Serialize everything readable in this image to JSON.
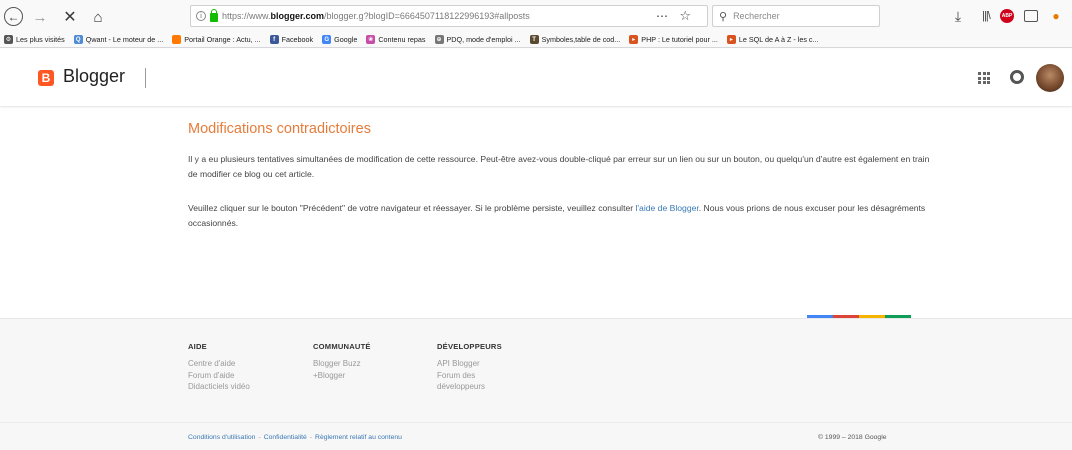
{
  "browser": {
    "url_prefix": "https://www.",
    "url_host": "blogger.com",
    "url_path": "/blogger.g?blogID=6664507118122996193#allposts",
    "search_placeholder": "Rechercher",
    "bookmarks": [
      {
        "label": "Les plus visités",
        "icon": "gear-icon",
        "color": "#555555"
      },
      {
        "label": "Qwant - Le moteur de ...",
        "icon": "qwant-icon",
        "color": "#4e8ad6"
      },
      {
        "label": "Portail Orange : Actu, ...",
        "icon": "orange-icon",
        "color": "#ff7900"
      },
      {
        "label": "Facebook",
        "icon": "facebook-icon",
        "color": "#3b5998"
      },
      {
        "label": "Google",
        "icon": "google-icon",
        "color": "#4285f4"
      },
      {
        "label": "Contenu repas",
        "icon": "flower-icon",
        "color": "#c64ea8"
      },
      {
        "label": "PDQ, mode d'emploi ...",
        "icon": "globe-icon",
        "color": "#777777"
      },
      {
        "label": "Symboles,table de cod...",
        "icon": "t-icon",
        "color": "#5a4a2f"
      },
      {
        "label": "PHP : Le tutoriel pour ...",
        "icon": "bookmark-icon",
        "color": "#d9531e"
      },
      {
        "label": "Le SQL de A à Z - les c...",
        "icon": "bookmark-icon",
        "color": "#d9531e"
      }
    ]
  },
  "header": {
    "logo_letter": "B",
    "app_name": "Blogger"
  },
  "error": {
    "title": "Modifications contradictoires",
    "para1": "Il y a eu plusieurs tentatives simultanées de modification de cette ressource. Peut-être avez-vous double-cliqué par erreur sur un lien ou sur un bouton, ou quelqu'un d'autre est également en train de modifier ce blog ou cet article.",
    "para2_before": "Veuillez cliquer sur le bouton \"Précédent\" de votre navigateur et réessayer. Si le problème persiste, veuillez consulter ",
    "para2_link": "l'aide de Blogger",
    "para2_after": ". Nous vous prions de nous excuser pour les désagréments occasionnés."
  },
  "colors": {
    "accent": "#e67c3b",
    "link": "#3b78b4",
    "bar": [
      "#4285f4",
      "#db4437",
      "#f4b400",
      "#0f9d58"
    ]
  },
  "footer": {
    "columns": [
      {
        "heading": "AIDE",
        "links": [
          "Centre d'aide",
          "Forum d'aide",
          "Didacticiels vidéo"
        ]
      },
      {
        "heading": "COMMUNAUTÉ",
        "links": [
          "Blogger Buzz",
          "+Blogger"
        ]
      },
      {
        "heading": "DÉVELOPPEURS",
        "links": [
          "API Blogger",
          "Forum des",
          "développeurs"
        ]
      }
    ],
    "legal": [
      "Conditions d'utilisation",
      "Confidentialité",
      "Règlement relatif au contenu"
    ],
    "legal_separator": "-",
    "copyright": "© 1999 – 2018 Google"
  }
}
